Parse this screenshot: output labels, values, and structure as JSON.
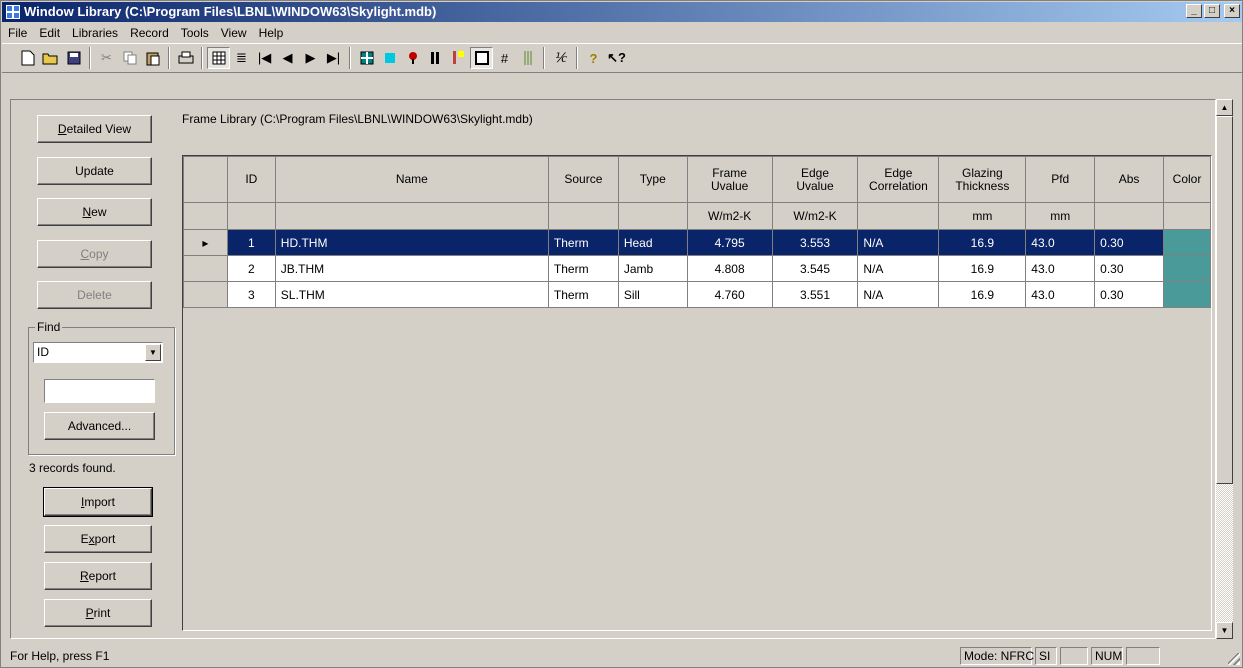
{
  "window": {
    "title": "Window Library (C:\\Program Files\\LBNL\\WINDOW63\\Skylight.mdb)",
    "min": "_",
    "max": "□",
    "close": "×"
  },
  "menu": [
    "File",
    "Edit",
    "Libraries",
    "Record",
    "Tools",
    "View",
    "Help"
  ],
  "buttons": {
    "detailed_view_pre": "",
    "detailed_view_u": "D",
    "detailed_view_post": "etailed View",
    "update": "Update",
    "new_u": "N",
    "new_post": "ew",
    "copy_u": "C",
    "copy_post": "opy",
    "delete": "Delete",
    "advanced": "Advanced...",
    "import_u": "I",
    "import_post": "mport",
    "export_pre": "E",
    "export_u": "x",
    "export_post": "port",
    "report_u": "R",
    "report_post": "eport",
    "print_u": "P",
    "print_post": "rint"
  },
  "find": {
    "label": "Find",
    "selected": "ID",
    "value": ""
  },
  "records_found": "3 records found.",
  "library_path": "Frame Library (C:\\Program Files\\LBNL\\WINDOW63\\Skylight.mdb)",
  "table": {
    "headers": [
      {
        "l1": "ID",
        "l2": ""
      },
      {
        "l1": "Name",
        "l2": ""
      },
      {
        "l1": "Source",
        "l2": ""
      },
      {
        "l1": "Type",
        "l2": ""
      },
      {
        "l1": "Frame",
        "l2": "Uvalue"
      },
      {
        "l1": "Edge",
        "l2": "Uvalue"
      },
      {
        "l1": "Edge",
        "l2": "Correlation"
      },
      {
        "l1": "Glazing",
        "l2": "Thickness"
      },
      {
        "l1": "Pfd",
        "l2": ""
      },
      {
        "l1": "Abs",
        "l2": ""
      },
      {
        "l1": "Color",
        "l2": ""
      }
    ],
    "units": [
      "",
      "",
      "",
      "",
      "W/m2-K",
      "W/m2-K",
      "",
      "mm",
      "mm",
      "",
      ""
    ],
    "rows": [
      {
        "id": "1",
        "name": "HD.THM",
        "source": "Therm",
        "type": "Head",
        "frame_u": "4.795",
        "edge_u": "3.553",
        "edge_corr": "N/A",
        "glazing": "16.9",
        "pfd": "43.0",
        "abs": "0.30",
        "selected": true
      },
      {
        "id": "2",
        "name": "JB.THM",
        "source": "Therm",
        "type": "Jamb",
        "frame_u": "4.808",
        "edge_u": "3.545",
        "edge_corr": "N/A",
        "glazing": "16.9",
        "pfd": "43.0",
        "abs": "0.30",
        "selected": false
      },
      {
        "id": "3",
        "name": "SL.THM",
        "source": "Therm",
        "type": "Sill",
        "frame_u": "4.760",
        "edge_u": "3.551",
        "edge_corr": "N/A",
        "glazing": "16.9",
        "pfd": "43.0",
        "abs": "0.30",
        "selected": false
      }
    ],
    "color_swatch": "#4a9a9a",
    "selected_marker": "▸"
  },
  "status": {
    "help": "For Help, press F1",
    "mode": "Mode: NFRC",
    "units": "SI",
    "num": "NUM"
  }
}
